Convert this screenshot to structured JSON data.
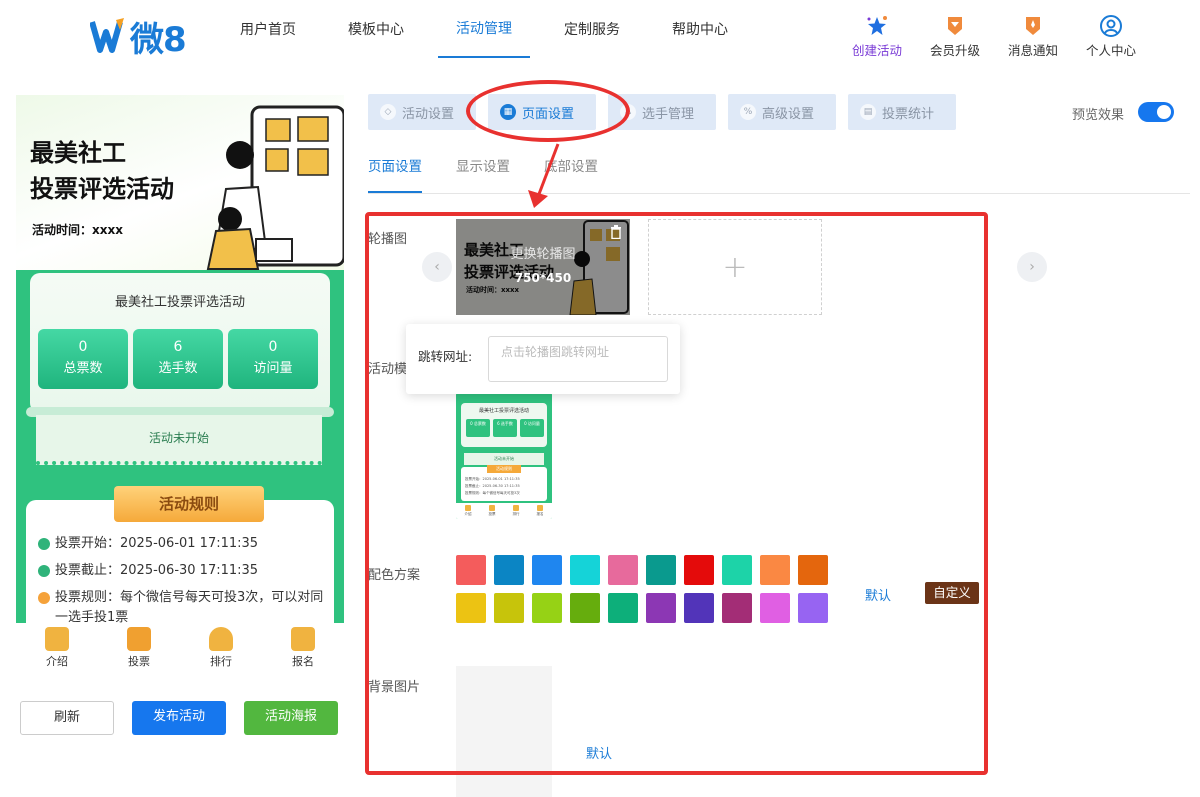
{
  "header": {
    "logo_text": "微8",
    "nav": [
      {
        "label": "用户首页",
        "active": false
      },
      {
        "label": "模板中心",
        "active": false
      },
      {
        "label": "活动管理",
        "active": true
      },
      {
        "label": "定制服务",
        "active": false
      },
      {
        "label": "帮助中心",
        "active": false
      }
    ],
    "actions": [
      {
        "label": "创建活动",
        "icon": "stars-icon",
        "color": "#7a3bd6"
      },
      {
        "label": "会员升级",
        "icon": "diamond-badge-icon",
        "color": "#f08a3c"
      },
      {
        "label": "消息通知",
        "icon": "bell-badge-icon",
        "color": "#f08a3c"
      },
      {
        "label": "个人中心",
        "icon": "user-circle-icon",
        "color": "#1a7bd6"
      }
    ]
  },
  "phone_preview": {
    "poster_title_line1": "最美社工",
    "poster_title_line2": "投票评选活动",
    "poster_time": "活动时间：xxxx",
    "card_title": "最美社工投票评选活动",
    "stats": [
      {
        "value": "0",
        "label": "总票数"
      },
      {
        "value": "6",
        "label": "选手数"
      },
      {
        "value": "0",
        "label": "访问量"
      }
    ],
    "status": "活动未开始",
    "rules_title": "活动规则",
    "rules": [
      {
        "text": "投票开始：2025-06-01 17:11:35",
        "dot_color": "#2fb37a"
      },
      {
        "text": "投票截止：2025-06-30 17:11:35",
        "dot_color": "#2fb37a"
      },
      {
        "text": "投票规则：每个微信号每天可投3次，可以对同一选手投1票",
        "dot_color": "#f5a23a"
      }
    ],
    "tabs": [
      {
        "label": "介绍",
        "icon": "intro-icon",
        "color": "#f0b340"
      },
      {
        "label": "投票",
        "icon": "vote-icon",
        "color": "#f0a030"
      },
      {
        "label": "排行",
        "icon": "trophy-icon",
        "color": "#f0b340"
      },
      {
        "label": "报名",
        "icon": "signup-icon",
        "color": "#f0b340"
      }
    ]
  },
  "buttons": {
    "refresh": "刷新",
    "publish": "发布活动",
    "poster": "活动海报"
  },
  "steps": [
    {
      "label": "活动设置",
      "icon": "shield-icon",
      "active": false
    },
    {
      "label": "页面设置",
      "icon": "page-icon",
      "active": true
    },
    {
      "label": "选手管理",
      "icon": "user-icon",
      "active": false
    },
    {
      "label": "高级设置",
      "icon": "percent-icon",
      "active": false
    },
    {
      "label": "投票统计",
      "icon": "chart-icon",
      "active": false
    }
  ],
  "preview_toggle": {
    "label": "预览效果",
    "on": true
  },
  "subtabs": [
    {
      "label": "页面设置",
      "active": true
    },
    {
      "label": "显示设置",
      "active": false
    },
    {
      "label": "底部设置",
      "active": false
    }
  ],
  "form": {
    "carousel_label": "轮播图",
    "carousel_replace": "更换轮播图",
    "carousel_size": "750*450",
    "jump_label": "跳转网址:",
    "jump_placeholder": "点击轮播图跳转网址",
    "jump_value": "",
    "template_label": "活动模",
    "template_thumb": {
      "title": "最美社工投票评选活动",
      "stats": [
        "0 总票数",
        "6 选手数",
        "0 访问量"
      ],
      "status": "活动未开始",
      "banner": "活动规则",
      "lines": [
        "投票开始：2025-06-01 17:11:35",
        "投票截止：2025-06-30 17:11:35",
        "投票规则：每个微信号每天可投3次"
      ],
      "tabs": [
        "介绍",
        "投票",
        "排行",
        "报名"
      ]
    },
    "color_label": "配色方案",
    "colors": [
      "#f45c5c",
      "#0b85c4",
      "#1f86ef",
      "#15d3d8",
      "#e76a9c",
      "#0a9a8e",
      "#e40b0b",
      "#1dd3a8",
      "#fa8843",
      "#e4660d",
      "#ecc313",
      "#c7c40b",
      "#96d215",
      "#66ad0d",
      "#0daf7a",
      "#8c37b4",
      "#5234b9",
      "#a32d76",
      "#e05fe3",
      "#9764f2"
    ],
    "color_default": "默认",
    "color_custom": "自定义",
    "bg_label": "背景图片",
    "bg_default": "默认"
  },
  "annotation_color": "#e8312f"
}
